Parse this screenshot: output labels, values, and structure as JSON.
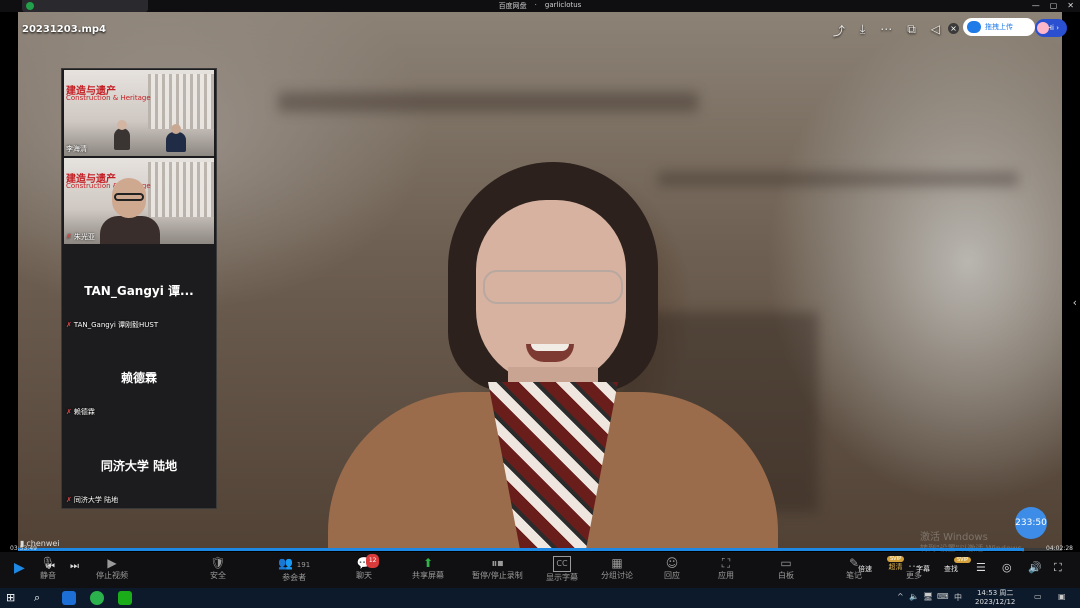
{
  "window": {
    "title": "百度网盘",
    "separator": "·",
    "user": "garliclotus",
    "controls": [
      "—",
      "▢",
      "✕"
    ]
  },
  "video": {
    "filename": "20231203.mp4",
    "top_icons": [
      "share-icon",
      "download-icon",
      "more-icon",
      "pip-icon",
      "pin-icon"
    ],
    "upload_label": "拖拽上传",
    "hi_label": "Hi",
    "side_arrow": "‹"
  },
  "gallery": [
    {
      "type": "video",
      "slide_title": "建造与遗产",
      "slide_sub": "Construction & Heritage",
      "label": "李海清",
      "muted": false
    },
    {
      "type": "video",
      "slide_title": "建造与遗产",
      "slide_sub": "Construction & Heritage",
      "label": "朱光亚",
      "muted": true
    },
    {
      "type": "name",
      "display": "TAN_Gangyi 谭...",
      "label": "TAN_Gangyi 谭刚毅HUST",
      "muted": true
    },
    {
      "type": "name",
      "display": "赖德霖",
      "label": "赖德霖",
      "muted": true
    },
    {
      "type": "name",
      "display": "同济大学 陆地",
      "label": "同济大学 陆地",
      "muted": true
    }
  ],
  "playback": {
    "elapsed": "03:53:49",
    "total": "04:02:28",
    "progress": 0.964,
    "speaker": "chenwei",
    "timer": "233:50"
  },
  "watermark": {
    "line1": "激活 Windows",
    "line2": "转到\"设置\"以激活 Windows。"
  },
  "controls": {
    "left": [
      {
        "name": "mute",
        "icon": "🎙",
        "label": "静音"
      },
      {
        "name": "stop-video",
        "icon": "▶",
        "label": "停止视频"
      },
      {
        "name": "security",
        "icon": "🛡",
        "label": "安全"
      },
      {
        "name": "participants",
        "icon": "👥",
        "label": "参会者",
        "count": "191"
      },
      {
        "name": "chat",
        "icon": "💬",
        "label": "聊天",
        "badge": "12"
      },
      {
        "name": "share-screen",
        "icon": "⬆",
        "label": "共享屏幕"
      },
      {
        "name": "pause-recording",
        "icon": "⏸⏹",
        "label": "暂停/停止录制"
      },
      {
        "name": "subtitles",
        "icon": "CC",
        "label": "显示字幕"
      },
      {
        "name": "breakout",
        "icon": "▦",
        "label": "分组讨论"
      },
      {
        "name": "reactions",
        "icon": "☺",
        "label": "回应"
      },
      {
        "name": "apps",
        "icon": "⛶",
        "label": "应用"
      },
      {
        "name": "whiteboard",
        "icon": "▭",
        "label": "白板"
      },
      {
        "name": "notes",
        "icon": "✎",
        "label": "笔记"
      },
      {
        "name": "more",
        "icon": "…",
        "label": "更多"
      }
    ],
    "right": {
      "speed": "倍速",
      "quality": "超清",
      "subtitle": "字幕",
      "search": "查找",
      "svip1": "SVIP",
      "svip2": "SVIP"
    }
  },
  "taskbar": {
    "time": "14:53 周二",
    "date": "2023/12/12",
    "ime": "中",
    "tray_icons": [
      "^",
      "🔈",
      "🖥",
      "⌨"
    ]
  }
}
